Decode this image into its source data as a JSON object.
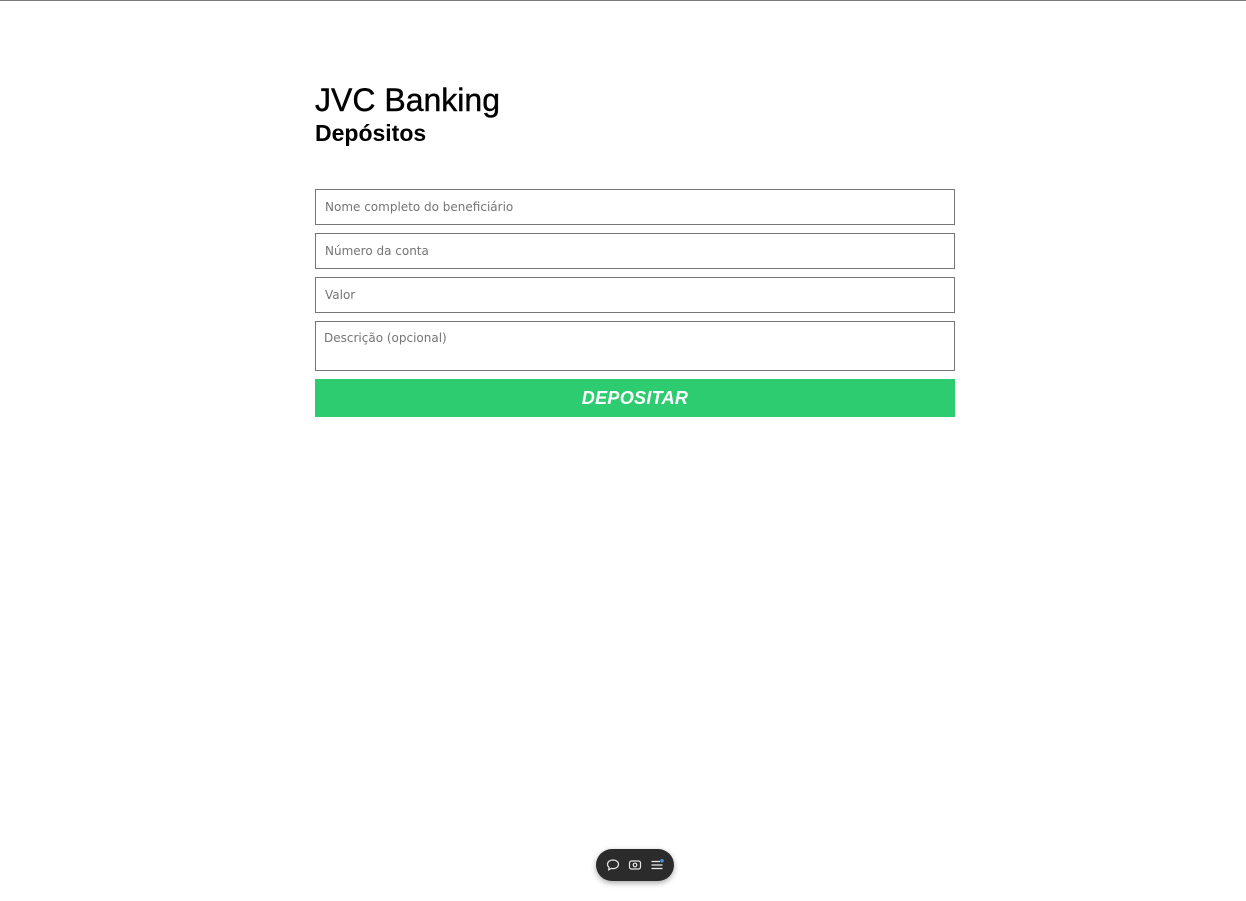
{
  "header": {
    "app_title": "JVC Banking",
    "page_title": "Depósitos"
  },
  "form": {
    "beneficiary_placeholder": "Nome completo do beneficiário",
    "account_placeholder": "Número da conta",
    "amount_placeholder": "Valor",
    "description_placeholder": "Descrição (opcional)",
    "submit_label": "DEPOSITAR"
  },
  "colors": {
    "submit_bg": "#2ecc71",
    "toolbar_bg": "#2b2b2b",
    "toolbar_accent": "#4a90e2"
  },
  "toolbar": {
    "icons": [
      "chat-icon",
      "camera-icon",
      "menu-icon"
    ]
  }
}
